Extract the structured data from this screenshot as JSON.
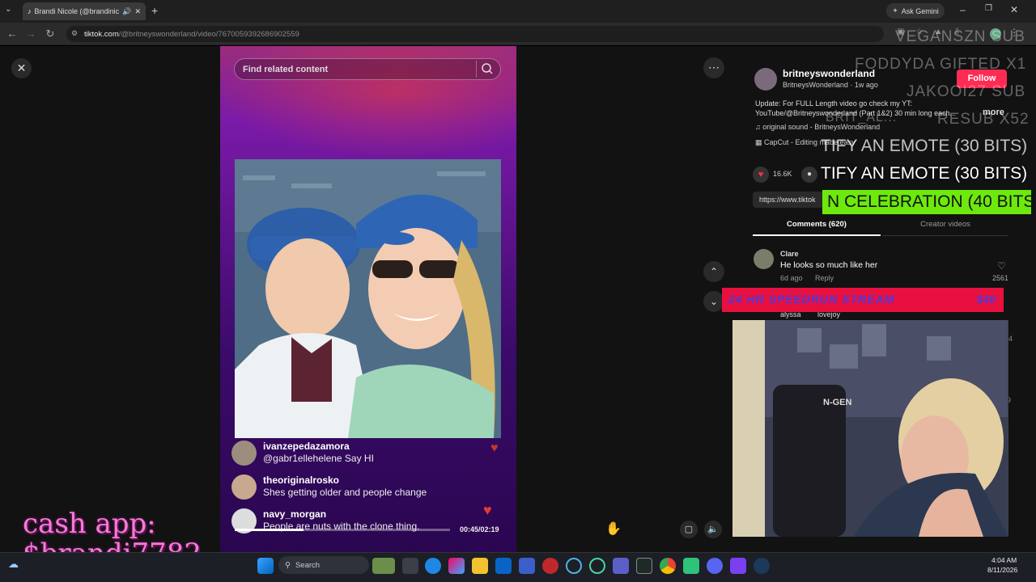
{
  "browser": {
    "tab_title": "Brandi Nicole (@brandinico",
    "url_host": "tiktok.com",
    "url_path": "/@britneyswonderland/video/7670059392686902559",
    "ask_gemini": "Ask Gemini"
  },
  "tiktok": {
    "search_placeholder": "Find related content",
    "overlay_comments": [
      {
        "user": "ivanzepedazamora",
        "text": "@gabr1ellehelene Say HI"
      },
      {
        "user": "theoriginalrosko",
        "text": "Shes getting older and people change"
      },
      {
        "user": "navy_morgan",
        "text": "People are nuts with the clone thing."
      }
    ],
    "time": "00:45/02:19",
    "progress": 0.32,
    "author_handle": "britneyswonderland",
    "author_name": "BritneysWonderland · 1w ago",
    "follow_label": "Follow",
    "description": "Update: For FULL Length video go check my YT: YouTube/@Britneyswonderland (Part 1&2) 30 min long each...",
    "more_label": "more",
    "sound": "original sound - BritneysWonderland",
    "capcut": "CapCut - Editing made easy",
    "likes": "16.6K",
    "link_text": "https://www.tiktok",
    "tab_comments": "Comments (620)",
    "tab_creator": "Creator videos",
    "comment": {
      "user": "Clare",
      "text": "He looks so much like her",
      "time": "6d ago",
      "reply": "Reply",
      "likes": "2561"
    },
    "next_comment_user": "alyssa",
    "next_comment_text": "lovejoy",
    "side_count_1": "4",
    "side_count_2": "9"
  },
  "stream_overlays": {
    "alerts": [
      "VEGANSZN SUB",
      "FODDYDA GIFTED X1",
      "JAKOOI27 SUB",
      "BRIT_AL...",
      "RESUB X52"
    ],
    "emote1": "TIFY AN EMOTE (30 BITS)",
    "emote2": "TIFY AN EMOTE (30 BITS)",
    "celebration": "N CELEBRATION (40 BITS)",
    "speedrun_label": "24 HR SPEEDRUN STREAM",
    "speedrun_amount": "$40",
    "webcam_chair_text": "N-GEN",
    "cashapp": "cash app:\n$brandi7782"
  },
  "taskbar": {
    "search_label": "Search",
    "time": "4:04 AM",
    "date": "8/11/2026"
  }
}
